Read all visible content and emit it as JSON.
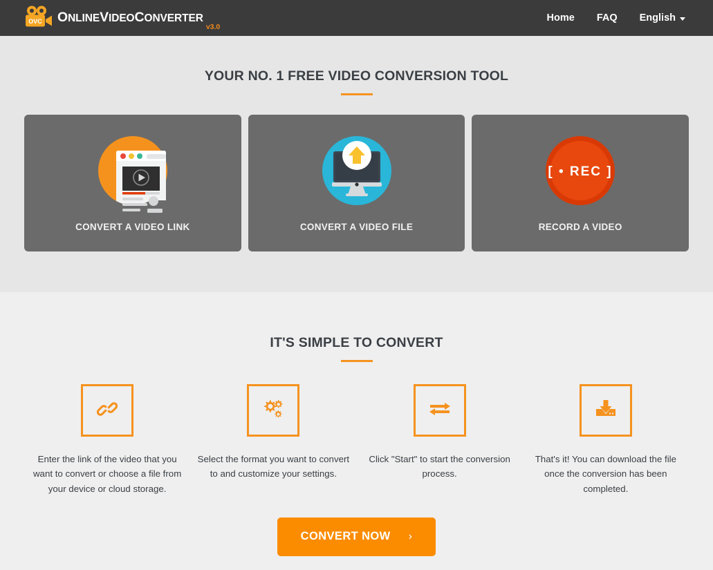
{
  "header": {
    "logo_icon": "video-camera-icon",
    "logo_badge_text": "OVC",
    "brand": {
      "part1_cap": "O",
      "part1_rest": "NLINE",
      "part2_cap": "V",
      "part2_rest": "IDEO",
      "part3_cap": "C",
      "part3_rest": "ONVERTER",
      "version": "v3.0"
    },
    "nav": [
      {
        "label": "Home",
        "name": "nav-home"
      },
      {
        "label": "FAQ",
        "name": "nav-faq"
      },
      {
        "label": "English",
        "name": "nav-language",
        "has_caret": true
      }
    ]
  },
  "hero": {
    "title": "YOUR NO. 1 FREE VIDEO CONVERSION TOOL",
    "cards": [
      {
        "label": "CONVERT A VIDEO LINK",
        "icon": "browser-video-link-icon",
        "accent": "#f5921e"
      },
      {
        "label": "CONVERT A VIDEO FILE",
        "icon": "monitor-upload-icon",
        "accent": "#29b6d8"
      },
      {
        "label": "RECORD A VIDEO",
        "icon": "rec-button-icon",
        "accent": "#e03c0a",
        "icon_text": "[ • REC ]"
      }
    ]
  },
  "steps_section": {
    "title": "IT'S SIMPLE TO CONVERT",
    "steps": [
      {
        "icon": "link-chain-icon",
        "text": "Enter the link of the video that you want to convert or choose a file from your device or cloud storage."
      },
      {
        "icon": "gears-settings-icon",
        "text": "Select the format you want to convert to and customize your settings."
      },
      {
        "icon": "exchange-arrows-icon",
        "text": "Click \"Start\" to start the conversion process."
      },
      {
        "icon": "download-icon",
        "text": "That's it! You can download the file once the conversion has been completed."
      }
    ],
    "cta_label": "CONVERT NOW",
    "cta_chevron": "›"
  },
  "colors": {
    "header_bg": "#3b3b3b",
    "hero_bg": "#e6e6e6",
    "steps_bg": "#efefef",
    "card_bg": "#6b6b6b",
    "accent_orange": "#f5921e",
    "cta_orange": "#fb8c00"
  }
}
